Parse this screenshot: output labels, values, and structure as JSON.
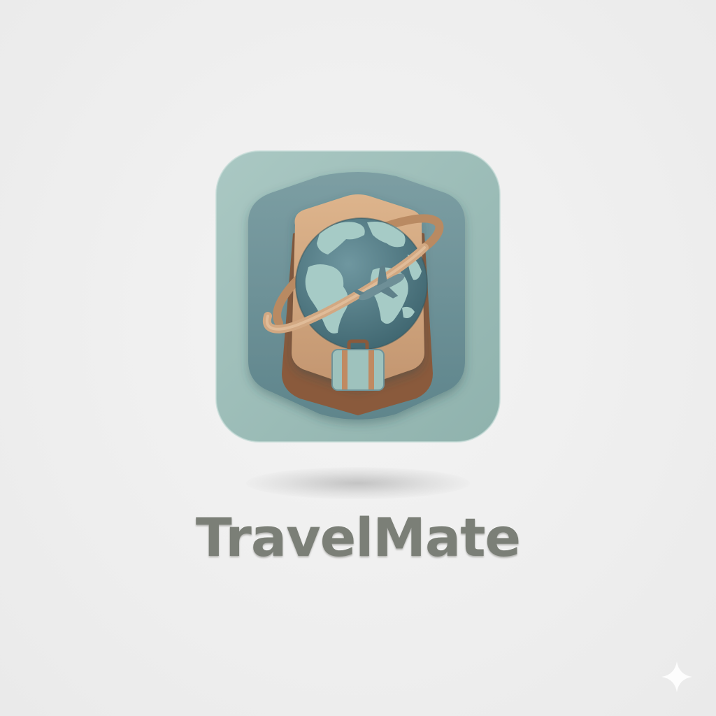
{
  "app": {
    "name": "TravelMate"
  },
  "icon": {
    "name": "travelmate-app-icon",
    "elements": [
      "globe-icon",
      "orbit-ring",
      "airplane-icon",
      "suitcase-icon",
      "hexagon-badge"
    ]
  },
  "colors": {
    "background": "#efefef",
    "tile": "#9dbcb7",
    "tile_inner": "#6f9399",
    "globe_ocean": "#4f7882",
    "globe_land": "#a6cbc6",
    "hexagon_tan": "#cfa47c",
    "hexagon_brown": "#8a5a3c",
    "text": "#7b7f77"
  },
  "watermark": {
    "icon": "sparkle-icon"
  }
}
